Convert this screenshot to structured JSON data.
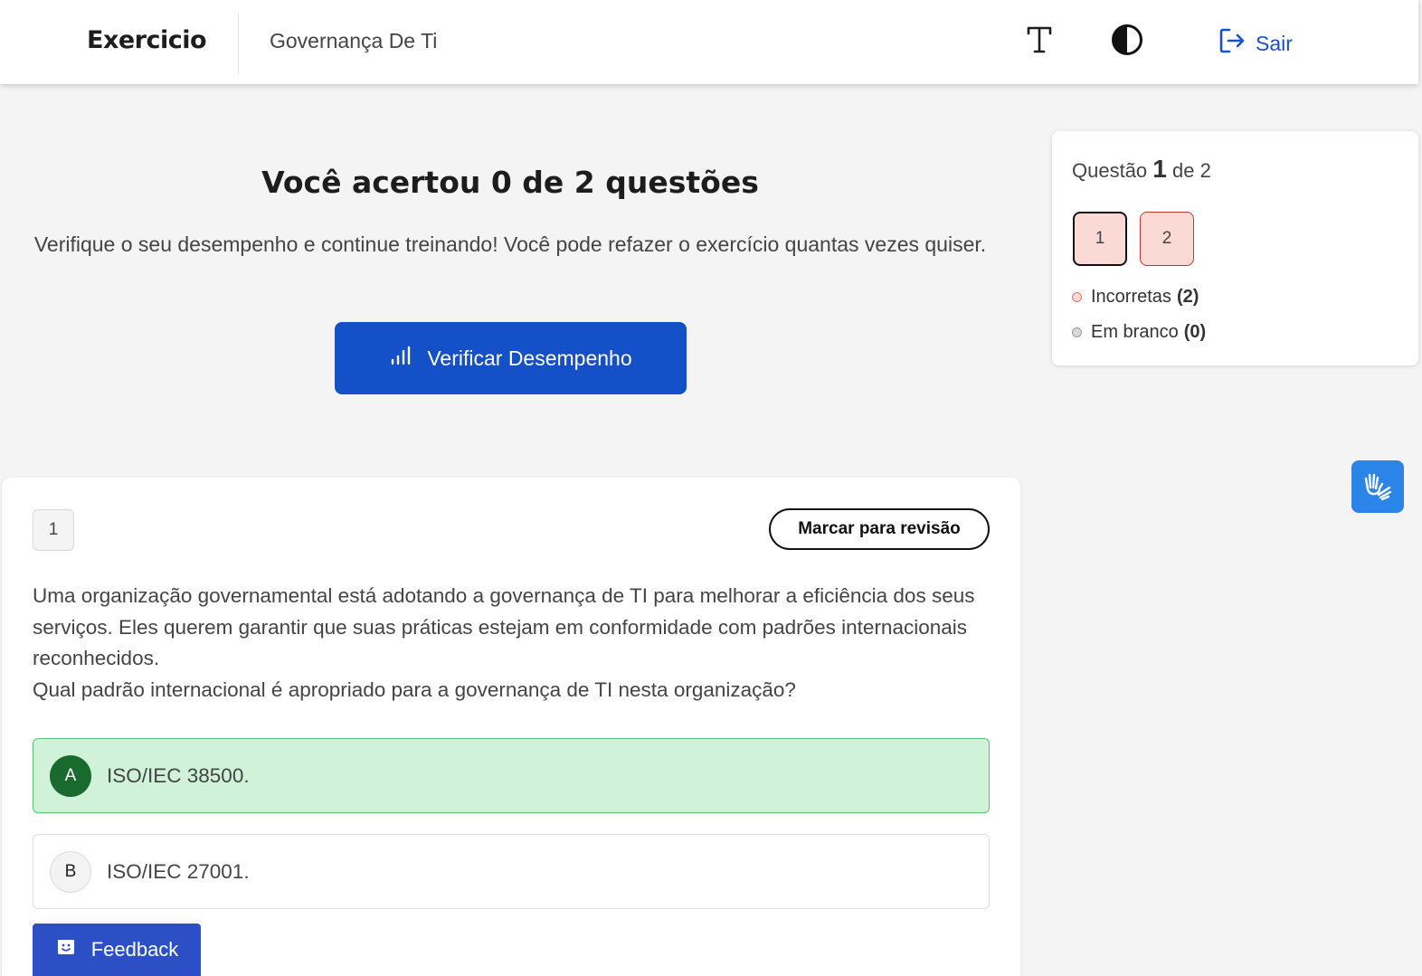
{
  "header": {
    "brand": "Exercicio",
    "course": "Governança De Ti",
    "font_icon": "text-size-icon",
    "contrast_icon": "contrast-icon",
    "logout_label": "Sair",
    "logout_icon": "logout-icon"
  },
  "result": {
    "title": "Você acertou 0 de 2 questões",
    "text": "Verifique o seu desempenho e continue treinando! Você pode refazer o exercício quantas vezes quiser.",
    "button_label": "Verificar Desempenho",
    "button_icon": "bar-chart-icon"
  },
  "question": {
    "number": "1",
    "review_label": "Marcar para revisão",
    "text_lines": [
      "Uma organização governamental está adotando a governança de TI para melhorar a eficiência dos seus serviços. Eles querem garantir que suas práticas estejam em conformidade com padrões internacionais reconhecidos.",
      "Qual padrão internacional é apropriado para a governança de TI nesta organização?"
    ],
    "options": [
      {
        "letter": "A",
        "text": "ISO/IEC 38500.",
        "state": "correct"
      },
      {
        "letter": "B",
        "text": "ISO/IEC 27001.",
        "state": "neutral"
      }
    ]
  },
  "sidebar": {
    "label_prefix": "Questão",
    "current": "1",
    "label_suffix": "de 2",
    "nav": [
      "1",
      "2"
    ],
    "legend": [
      {
        "label": "Incorretas",
        "count": "(2)"
      },
      {
        "label": "Em branco",
        "count": "(0)"
      }
    ]
  },
  "feedback": {
    "label": "Feedback",
    "icon": "smile-face-icon"
  },
  "accessibility": {
    "icon": "sign-language-hands-icon"
  },
  "colors": {
    "primary": "#1450c8",
    "correct_bg": "#cff2d9",
    "correct_dark": "#1b6a2d",
    "incorrect_bg": "#fbdad6",
    "link": "#1a50d0"
  }
}
